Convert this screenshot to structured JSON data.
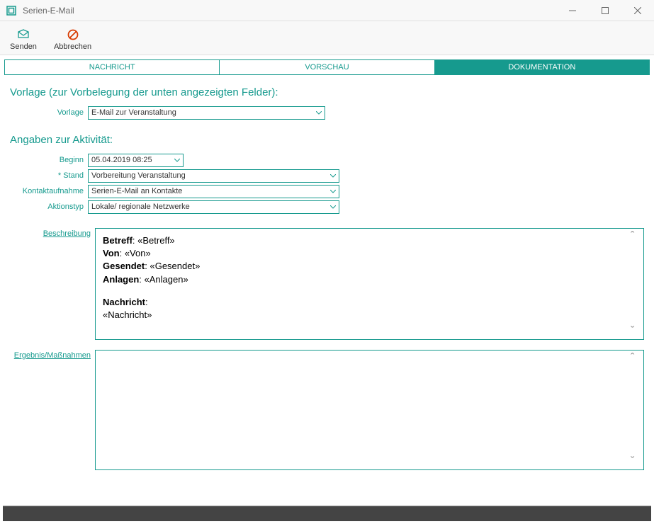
{
  "window": {
    "title": "Serien-E-Mail"
  },
  "toolbar": {
    "send": "Senden",
    "cancel": "Abbrechen"
  },
  "tabs": {
    "message": "NACHRICHT",
    "preview": "VORSCHAU",
    "documentation": "DOKUMENTATION"
  },
  "sections": {
    "template_heading": "Vorlage (zur Vorbelegung der unten angezeigten Felder):",
    "activity_heading": "Angaben zur Aktivität:"
  },
  "form": {
    "vorlage_label": "Vorlage",
    "vorlage_value": "E-Mail zur Veranstaltung",
    "beginn_label": "Beginn",
    "beginn_value": "05.04.2019 08:25",
    "stand_label": "* Stand",
    "stand_value": "Vorbereitung Veranstaltung",
    "kontakt_label": "Kontaktaufnahme",
    "kontakt_value": "Serien-E-Mail an Kontakte",
    "aktionstyp_label": "Aktionstyp",
    "aktionstyp_value": "Lokale/ regionale Netzwerke",
    "beschreibung_label": "Beschreibung",
    "ergebnis_label": "Ergebnis/Maßnahmen"
  },
  "description": {
    "betreff_label": "Betreff",
    "betreff_value": "«Betreff»",
    "von_label": "Von",
    "von_value": "«Von»",
    "gesendet_label": "Gesendet",
    "gesendet_value": "«Gesendet»",
    "anlagen_label": "Anlagen",
    "anlagen_value": "«Anlagen»",
    "nachricht_label": "Nachricht",
    "nachricht_value": "«Nachricht»"
  }
}
